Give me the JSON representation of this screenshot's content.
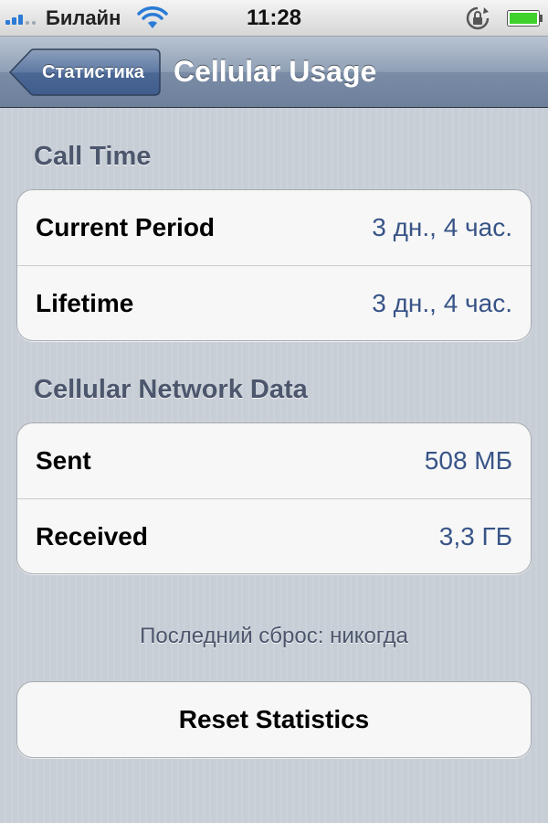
{
  "status_bar": {
    "carrier": "Билайн",
    "time": "11:28",
    "icons": [
      "signal-icon",
      "wifi-icon",
      "rotation-lock-icon",
      "battery-icon"
    ],
    "battery_color": "#3fd12c",
    "signal_color": "#2a7bd6"
  },
  "nav": {
    "back_label": "Статистика",
    "title": "Cellular Usage",
    "bar_color": "#7a8ca6"
  },
  "sections": {
    "call_time": {
      "header": "Call Time",
      "rows": [
        {
          "label": "Current Period",
          "value": "3 дн., 4 час."
        },
        {
          "label": "Lifetime",
          "value": "3 дн., 4 час."
        }
      ]
    },
    "network_data": {
      "header": "Cellular Network Data",
      "rows": [
        {
          "label": "Sent",
          "value": "508 МБ"
        },
        {
          "label": "Received",
          "value": "3,3 ГБ"
        }
      ]
    }
  },
  "footer": {
    "last_reset": "Последний сброс: никогда",
    "reset_button": "Reset Statistics"
  },
  "colors": {
    "value_text": "#385487",
    "section_header": "#4c566c"
  }
}
